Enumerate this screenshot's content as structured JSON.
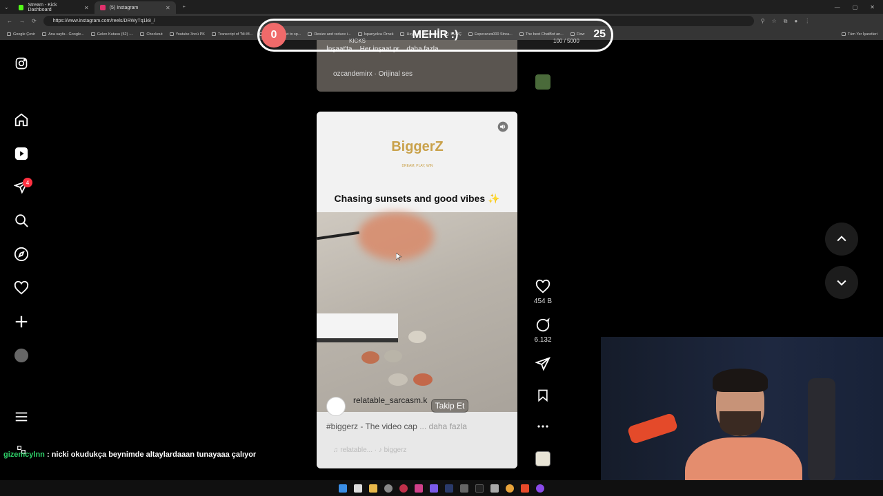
{
  "browser": {
    "tabs": [
      {
        "title": "Stream - Kick Dashboard",
        "color": "#53fc18",
        "active": false
      },
      {
        "title": "(5) Instagram",
        "color": "#e1306c",
        "active": true
      }
    ],
    "url": "https://www.instagram.com/reels/DRWyTq1k8_/",
    "bookmarks": [
      "Google Çevir",
      "Ana sayfa - Google...",
      "Gelen Kutusu (52) -...",
      "Checkout",
      "Youtube 3ncü PK",
      "Transcript of \"Mi M...",
      "CapCut | Text to sp...",
      "Resize and reduce i...",
      "İspanyolca Örnek",
      "HeyGen - Projects",
      "BURÇ",
      "Esperanza000 Strea...",
      "The best ChatBot an...",
      "Flow",
      "Tüm Yer İşaretleri"
    ]
  },
  "overlay": {
    "left_value": "0",
    "name": "MEHİR :)",
    "right_value": "25",
    "kicks_label": "KICKS",
    "kicks_count": "100 / 5000"
  },
  "sidebar": {
    "items": [
      "instagram-logo",
      "home",
      "reels",
      "messages",
      "search",
      "explore",
      "notifications",
      "create",
      "profile",
      "more",
      "meta"
    ],
    "messages_badge": "4"
  },
  "previous_reel": {
    "caption": "İnşaat'ta... Her inşaat pr... daha fazla",
    "audio": "ozcandemirx · Orijinal ses"
  },
  "reel": {
    "logo": "BiggerZ",
    "logo_tagline": "DREAM, PLAY, WIN",
    "title": "Chasing sunsets and good vibes ✨",
    "username": "relatable_sarcasm.k",
    "follow_label": "Takip Et",
    "caption": "#biggerz - The video cap",
    "caption_more": "... daha fazla",
    "audio": "♫  relatable... · ♪ biggerz"
  },
  "actions": {
    "likes": "454 B",
    "comments": "6.132"
  },
  "chat": {
    "user": "gizemcylnn",
    "message": ": nicki okudukça beynimde altaylardaaan tunayaaa çalıyor"
  },
  "colors": {
    "accent_red": "#ff3040",
    "overlay_pink": "#f06a6a",
    "gold": "#c9a14a",
    "chat_green": "#2fd36a"
  }
}
